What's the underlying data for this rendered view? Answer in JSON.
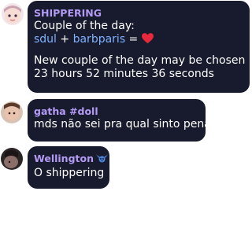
{
  "messages": [
    {
      "sender": "SHIPPERING",
      "line1": "Couple of the day:",
      "couple_a": "sdul",
      "plus": " + ",
      "couple_b": "barbparis",
      "equals": " = ",
      "heart_icon": "red-heart-emoji",
      "line3": "New couple of the day may be chosen in",
      "line4": "23 hours 52 minutes 36 seconds"
    },
    {
      "sender": "gatha #doll",
      "text": "mds não sei pra qual sinto pena"
    },
    {
      "sender": "Wellington",
      "badge_icon": "stitch-emoji",
      "text": "O shippering"
    }
  ],
  "colors": {
    "bubble": "#181a2d",
    "sender": "#b39bf4",
    "mention": "#7eb2ff",
    "heart": "#e8283c"
  }
}
